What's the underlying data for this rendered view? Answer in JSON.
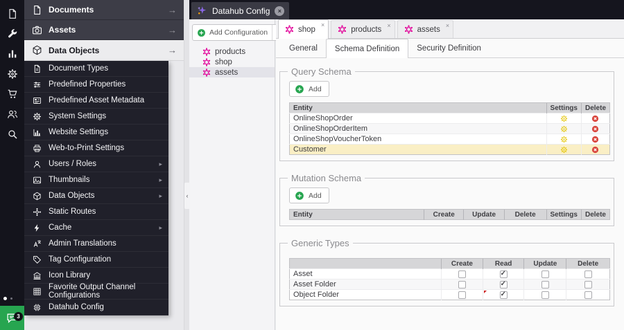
{
  "colors": {
    "accent_pink": "#e10098",
    "accent_green": "#27a550",
    "settings_yellow": "#e4c400",
    "danger_red": "#d9453d",
    "row_highlight": "#faefc5",
    "sidebar_dark": "#20202a",
    "topbar_dark": "#15151e"
  },
  "iconbar": {
    "items": [
      {
        "name": "documents-icon",
        "icon": "file"
      },
      {
        "name": "tools-icon",
        "icon": "wrench"
      },
      {
        "name": "reports-icon",
        "icon": "bar-chart"
      },
      {
        "name": "settings-icon",
        "icon": "gear"
      },
      {
        "name": "ecommerce-icon",
        "icon": "cart"
      },
      {
        "name": "users-icon",
        "icon": "users"
      },
      {
        "name": "search-icon",
        "icon": "search"
      }
    ],
    "chat_badge": "3"
  },
  "sidebar": {
    "sections": [
      {
        "label": "Documents",
        "icon": "file",
        "active": false
      },
      {
        "label": "Assets",
        "icon": "camera",
        "active": false
      },
      {
        "label": "Data Objects",
        "icon": "cube",
        "active": true
      }
    ],
    "menu_items": [
      {
        "label": "Document Types",
        "icon": "doc-type",
        "submenu": false
      },
      {
        "label": "Predefined Properties",
        "icon": "sliders",
        "submenu": false
      },
      {
        "label": "Predefined Asset Metadata",
        "icon": "metadata",
        "submenu": false
      },
      {
        "label": "System Settings",
        "icon": "gear",
        "submenu": false
      },
      {
        "label": "Website Settings",
        "icon": "chart-mixed",
        "submenu": false
      },
      {
        "label": "Web-to-Print Settings",
        "icon": "printer",
        "submenu": false
      },
      {
        "label": "Users / Roles",
        "icon": "user",
        "submenu": true
      },
      {
        "label": "Thumbnails",
        "icon": "image",
        "submenu": true
      },
      {
        "label": "Data Objects",
        "icon": "cube",
        "submenu": true
      },
      {
        "label": "Static Routes",
        "icon": "hub",
        "submenu": false
      },
      {
        "label": "Cache",
        "icon": "bolt",
        "submenu": true
      },
      {
        "label": "Admin Translations",
        "icon": "translate",
        "submenu": false
      },
      {
        "label": "Tag Configuration",
        "icon": "tag",
        "submenu": false
      },
      {
        "label": "Icon Library",
        "icon": "bank",
        "submenu": false
      },
      {
        "label": "Favorite Output Channel Configurations",
        "icon": "grid",
        "submenu": false
      },
      {
        "label": "Datahub Config",
        "icon": "chip",
        "submenu": false
      }
    ]
  },
  "main_tabbar": {
    "tabs": [
      {
        "label": "Datahub Config",
        "icon": "sparkle",
        "active": true,
        "closable": true
      }
    ]
  },
  "config_panel": {
    "add_button_label": "Add Configuration",
    "tree": [
      {
        "label": "products",
        "selected": false
      },
      {
        "label": "shop",
        "selected": false
      },
      {
        "label": "assets",
        "selected": true
      }
    ]
  },
  "editor": {
    "tabs": [
      {
        "label": "shop",
        "active": true
      },
      {
        "label": "products",
        "active": false
      },
      {
        "label": "assets",
        "active": false
      }
    ],
    "subtabs": [
      {
        "label": "General",
        "active": false
      },
      {
        "label": "Schema Definition",
        "active": true
      },
      {
        "label": "Security Definition",
        "active": false
      }
    ],
    "query_schema": {
      "legend": "Query Schema",
      "add_label": "Add",
      "columns": [
        "Entity",
        "Settings",
        "Delete"
      ],
      "rows": [
        {
          "entity": "OnlineShopOrder",
          "highlighted": false
        },
        {
          "entity": "OnlineShopOrderItem",
          "highlighted": false
        },
        {
          "entity": "OnlineShopVoucherToken",
          "highlighted": false
        },
        {
          "entity": "Customer",
          "highlighted": true
        }
      ]
    },
    "mutation_schema": {
      "legend": "Mutation Schema",
      "add_label": "Add",
      "columns": [
        "Entity",
        "Create",
        "Update",
        "Delete",
        "Settings",
        "Delete"
      ],
      "rows": []
    },
    "generic_types": {
      "legend": "Generic Types",
      "columns": [
        "",
        "Create",
        "Read",
        "Update",
        "Delete"
      ],
      "perm_keys": [
        "create",
        "read",
        "update",
        "delete"
      ],
      "rows": [
        {
          "label": "Asset",
          "create": false,
          "read": true,
          "update": false,
          "delete": false,
          "dirty": false
        },
        {
          "label": "Asset Folder",
          "create": false,
          "read": true,
          "update": false,
          "delete": false,
          "dirty": false
        },
        {
          "label": "Object Folder",
          "create": false,
          "read": true,
          "update": false,
          "delete": false,
          "dirty": true
        }
      ]
    }
  }
}
